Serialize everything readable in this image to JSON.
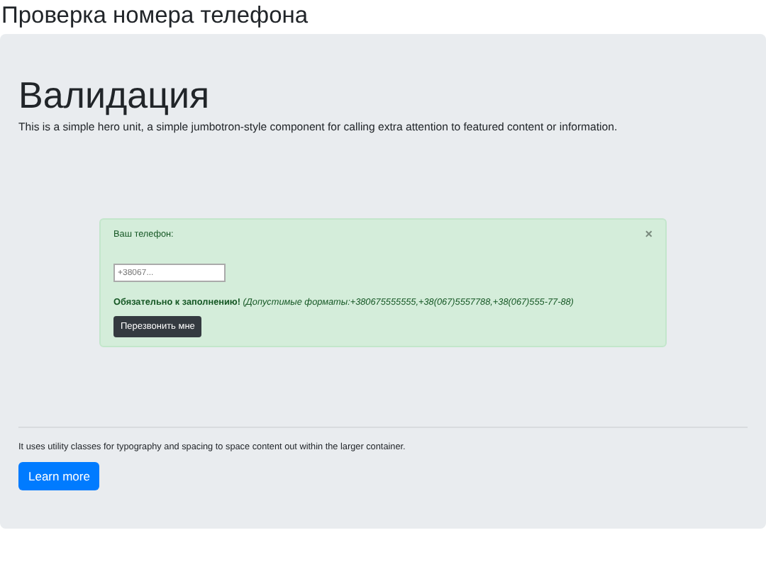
{
  "page_title": "Проверка номера телефона",
  "hero": {
    "heading": "Валидация",
    "lead": "This is a simple hero unit, a simple jumbotron-style component for calling extra attention to featured content or information.",
    "alert": {
      "label": "Ваш телефон:",
      "close": "×",
      "phone_field": {
        "placeholder": "+38067..."
      },
      "note": "**Обязательно к заполнению!** *(Допустимые форматы:+380675555555,+38(067)5557788,+38(067)555-77-88)*",
      "button": "Перезвонить мне"
    },
    "text": "It uses utility classes for typography and spacing to space content out within the larger container.",
    "button": "Learn more"
  }
}
